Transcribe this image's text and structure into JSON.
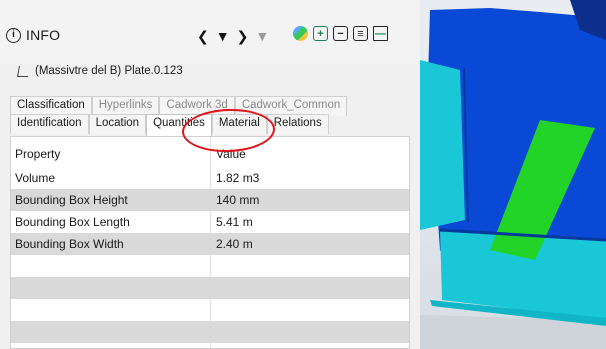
{
  "header": {
    "title": "INFO",
    "info_icon": "info-circle-icon",
    "nav_buttons": [
      "chevron-left-icon",
      "caret-down-icon",
      "chevron-right-icon",
      "caret-down-disabled-icon"
    ],
    "tool_icons": [
      "color-map-icon",
      "expand-add-icon",
      "collapse-remove-icon",
      "collapse-list-icon",
      "window-icon"
    ]
  },
  "element": {
    "icon": "plate-icon",
    "name": "(Massivtre del B) Plate.0.123"
  },
  "tabs": {
    "row1": [
      {
        "label": "Classification"
      },
      {
        "label": "Hyperlinks"
      },
      {
        "label": "Cadwork 3d"
      },
      {
        "label": "Cadwork_Common"
      }
    ],
    "row2": [
      {
        "label": "Identification"
      },
      {
        "label": "Location"
      },
      {
        "label": "Quantities"
      },
      {
        "label": "Material"
      },
      {
        "label": "Relations"
      }
    ],
    "active": "Quantities"
  },
  "table": {
    "headers": [
      "Property",
      "Value"
    ],
    "rows": [
      {
        "property": "Volume",
        "value": "1.82 m3"
      },
      {
        "property": "Bounding Box Height",
        "value": "140 mm"
      },
      {
        "property": "Bounding Box Length",
        "value": "5.41 m"
      },
      {
        "property": "Bounding Box Width",
        "value": "2.40 m"
      }
    ]
  },
  "annotation": {
    "color": "#e0151b"
  },
  "colors": {
    "cyan": "#19c7d6",
    "blue": "#0a49d6",
    "green": "#22d428",
    "dark_blue": "#0b2f8a"
  }
}
